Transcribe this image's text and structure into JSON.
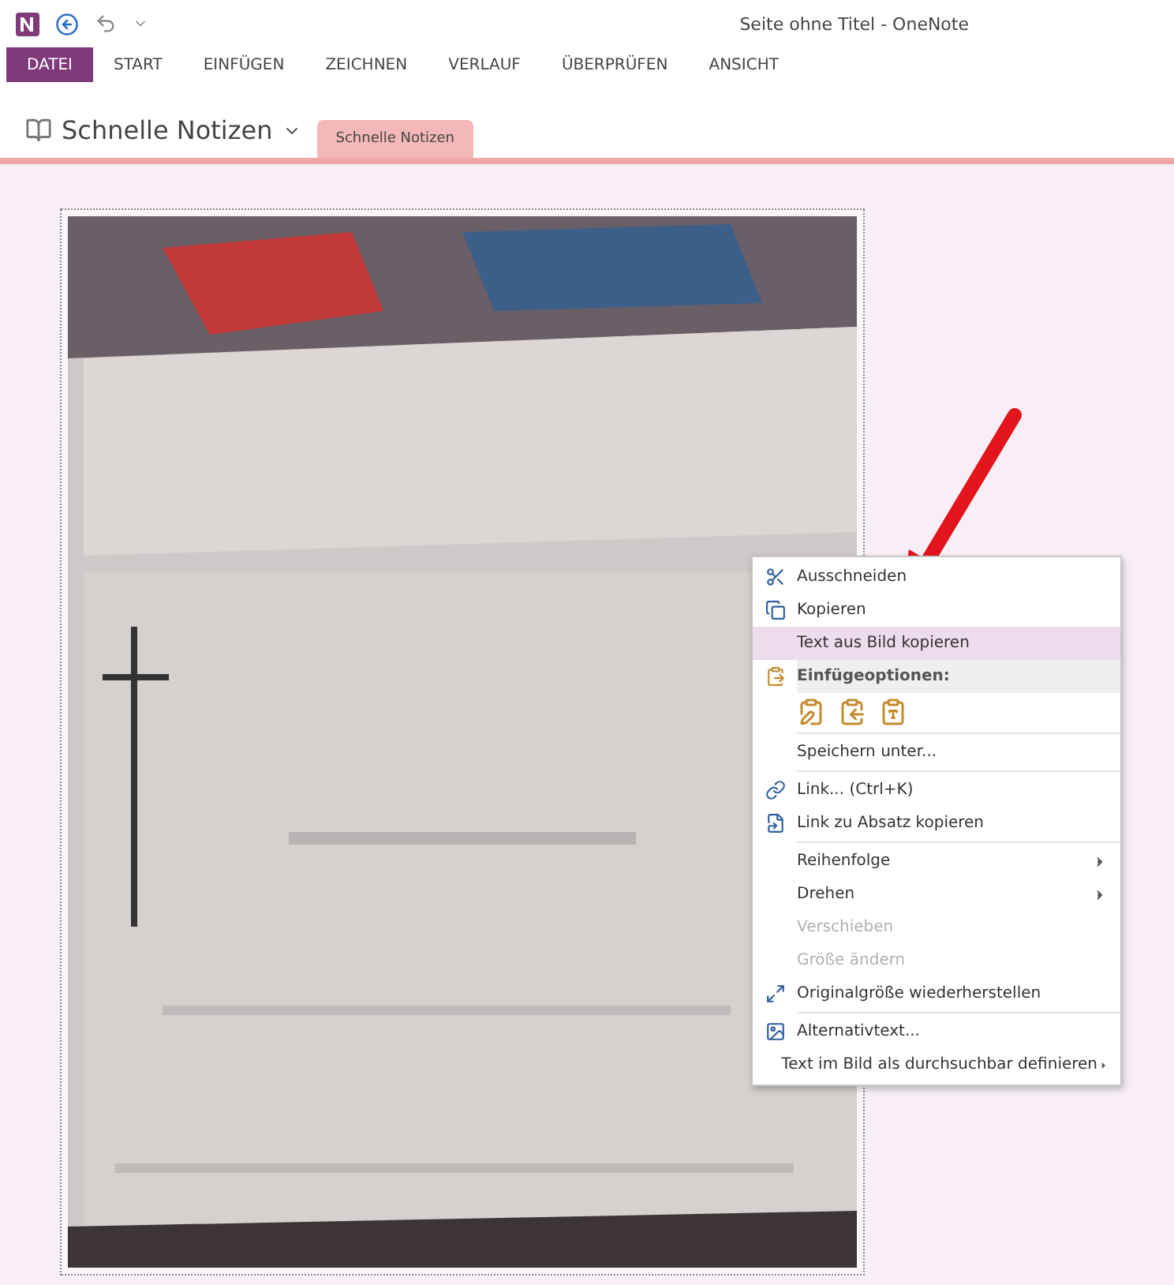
{
  "window": {
    "title": "Seite ohne Titel - OneNote"
  },
  "ribbon_tabs": [
    {
      "label": "DATEI",
      "selected": true
    },
    {
      "label": "START",
      "selected": false
    },
    {
      "label": "EINFÜGEN",
      "selected": false
    },
    {
      "label": "ZEICHNEN",
      "selected": false
    },
    {
      "label": "VERLAUF",
      "selected": false
    },
    {
      "label": "ÜBERPRÜFEN",
      "selected": false
    },
    {
      "label": "ANSICHT",
      "selected": false
    }
  ],
  "notebook": {
    "name": "Schnelle Notizen"
  },
  "section_tabs": [
    {
      "label": "Schnelle Notizen",
      "selected": true
    }
  ],
  "page": {
    "image": {
      "kind": "picture",
      "selected": true
    }
  },
  "context_menu": {
    "items": [
      {
        "kind": "item",
        "label": "Ausschneiden",
        "selected": false,
        "disabled": false,
        "submenu": false
      },
      {
        "kind": "item",
        "label": "Kopieren",
        "selected": false,
        "disabled": false,
        "submenu": false
      },
      {
        "kind": "item",
        "label": "Text aus Bild kopieren",
        "selected": true,
        "disabled": false,
        "submenu": false
      },
      {
        "kind": "header",
        "label": "Einfügeoptionen:"
      },
      {
        "kind": "paste_options"
      },
      {
        "kind": "separator"
      },
      {
        "kind": "item",
        "label": "Speichern unter...",
        "selected": false,
        "disabled": false,
        "submenu": false
      },
      {
        "kind": "separator"
      },
      {
        "kind": "item",
        "label": "Link...  (Ctrl+K)",
        "selected": false,
        "disabled": false,
        "submenu": false
      },
      {
        "kind": "item",
        "label": "Link zu Absatz kopieren",
        "selected": false,
        "disabled": false,
        "submenu": false
      },
      {
        "kind": "separator"
      },
      {
        "kind": "item",
        "label": "Reihenfolge",
        "selected": false,
        "disabled": false,
        "submenu": true
      },
      {
        "kind": "item",
        "label": "Drehen",
        "selected": false,
        "disabled": false,
        "submenu": true
      },
      {
        "kind": "item",
        "label": "Verschieben",
        "selected": false,
        "disabled": true,
        "submenu": false
      },
      {
        "kind": "item",
        "label": "Größe ändern",
        "selected": false,
        "disabled": true,
        "submenu": false
      },
      {
        "kind": "item",
        "label": "Originalgröße wiederherstellen",
        "selected": false,
        "disabled": false,
        "submenu": false
      },
      {
        "kind": "separator"
      },
      {
        "kind": "item",
        "label": "Alternativtext...",
        "selected": false,
        "disabled": false,
        "submenu": false
      },
      {
        "kind": "item",
        "label": "Text im Bild als durchsuchbar definieren",
        "selected": false,
        "disabled": false,
        "submenu": true
      }
    ]
  }
}
